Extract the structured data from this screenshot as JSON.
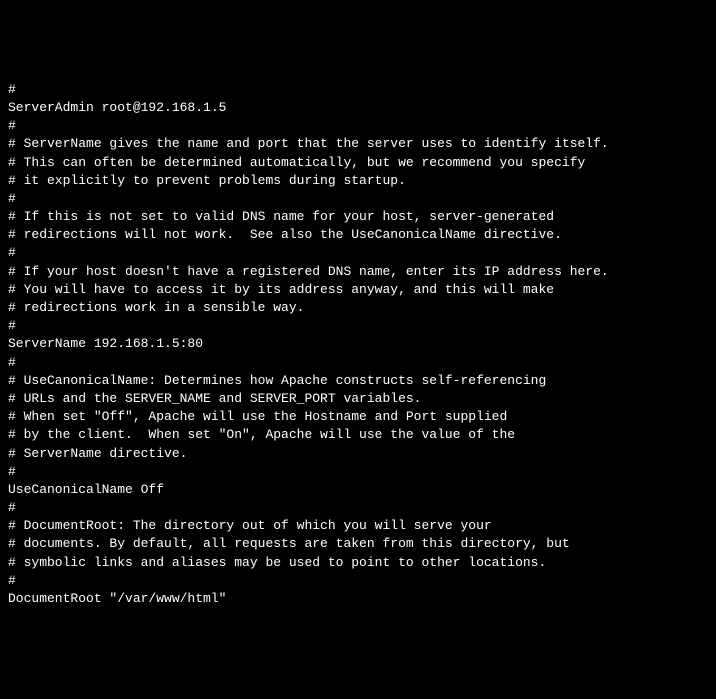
{
  "lines": [
    "#",
    "ServerAdmin root@192.168.1.5",
    "",
    "#",
    "# ServerName gives the name and port that the server uses to identify itself.",
    "# This can often be determined automatically, but we recommend you specify",
    "# it explicitly to prevent problems during startup.",
    "#",
    "# If this is not set to valid DNS name for your host, server-generated",
    "# redirections will not work.  See also the UseCanonicalName directive.",
    "#",
    "# If your host doesn't have a registered DNS name, enter its IP address here.",
    "# You will have to access it by its address anyway, and this will make",
    "# redirections work in a sensible way.",
    "#",
    "ServerName 192.168.1.5:80",
    "",
    "#",
    "# UseCanonicalName: Determines how Apache constructs self-referencing",
    "# URLs and the SERVER_NAME and SERVER_PORT variables.",
    "# When set \"Off\", Apache will use the Hostname and Port supplied",
    "# by the client.  When set \"On\", Apache will use the value of the",
    "# ServerName directive.",
    "#",
    "UseCanonicalName Off",
    "",
    "#",
    "# DocumentRoot: The directory out of which you will serve your",
    "# documents. By default, all requests are taken from this directory, but",
    "# symbolic links and aliases may be used to point to other locations.",
    "#",
    "DocumentRoot \"/var/www/html\""
  ]
}
